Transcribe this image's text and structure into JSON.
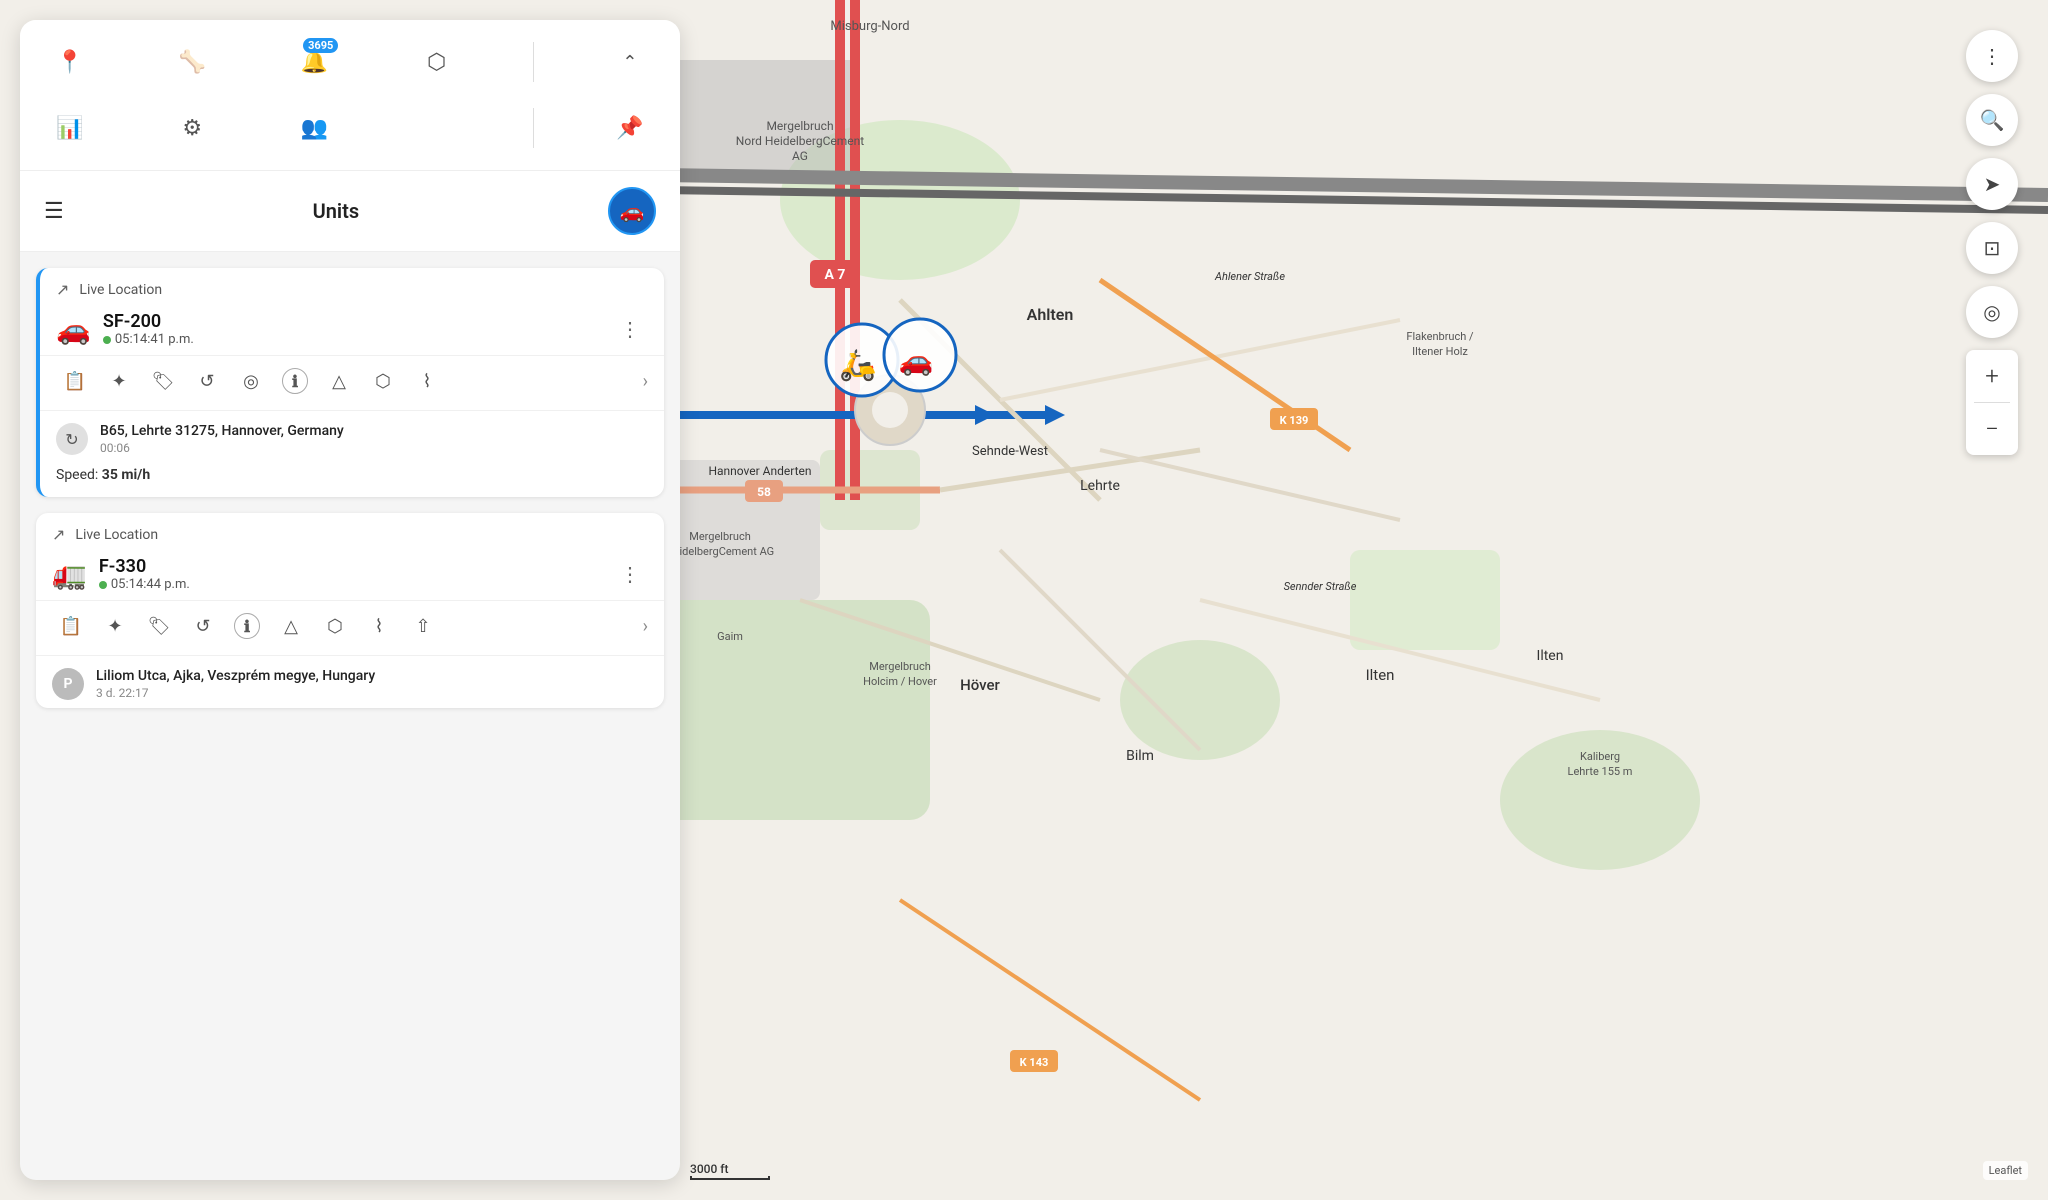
{
  "toolbar": {
    "icons": [
      {
        "name": "location-pin-icon",
        "symbol": "📍",
        "badge": null
      },
      {
        "name": "share-icon",
        "symbol": "🦴",
        "badge": null
      },
      {
        "name": "notifications-icon",
        "symbol": "🔔",
        "badge": "3695"
      },
      {
        "name": "select-area-icon",
        "symbol": "⬡",
        "badge": null
      },
      {
        "name": "collapse-icon",
        "symbol": "⌃",
        "badge": null
      },
      {
        "name": "chart-icon",
        "symbol": "📊",
        "badge": null
      },
      {
        "name": "settings-icon",
        "symbol": "⚙",
        "badge": null
      },
      {
        "name": "users-icon",
        "symbol": "👥",
        "badge": null
      },
      {
        "name": "pin-icon",
        "symbol": "📌",
        "badge": null
      }
    ]
  },
  "units_header": {
    "title": "Units",
    "menu_label": "☰"
  },
  "units": [
    {
      "id": "sf200",
      "live_location_label": "Live Location",
      "name": "SF-200",
      "time": "05:14:41 p.m.",
      "status": "online",
      "address": "B65, Lehrte 31275, Hannover, Germany",
      "time_ago": "00:06",
      "speed_label": "Speed:",
      "speed_value": "35 mi/h",
      "selected": true
    },
    {
      "id": "f330",
      "live_location_label": "Live Location",
      "name": "F-330",
      "time": "05:14:44 p.m.",
      "status": "online",
      "address": "Liliom Utca, Ajka, Veszprém megye, Hungary",
      "time_ago": "3 d. 22:17",
      "speed_label": null,
      "speed_value": null,
      "selected": false
    }
  ],
  "action_icons": [
    {
      "name": "report-icon",
      "symbol": "📋"
    },
    {
      "name": "route-icon",
      "symbol": "✦"
    },
    {
      "name": "bookmark-icon",
      "symbol": "🏷"
    },
    {
      "name": "replay-icon",
      "symbol": "↺"
    },
    {
      "name": "geofence-icon",
      "symbol": "◎"
    },
    {
      "name": "info-icon",
      "symbol": "ℹ"
    },
    {
      "name": "navigation-icon",
      "symbol": "△"
    },
    {
      "name": "shield-icon",
      "symbol": "⬡"
    },
    {
      "name": "path-icon",
      "symbol": "⌇"
    }
  ],
  "action_icons_2": [
    {
      "name": "report-icon",
      "symbol": "📋"
    },
    {
      "name": "route-icon",
      "symbol": "✦"
    },
    {
      "name": "bookmark-icon",
      "symbol": "🏷"
    },
    {
      "name": "replay-icon",
      "symbol": "↺"
    },
    {
      "name": "info-icon",
      "symbol": "ℹ"
    },
    {
      "name": "navigation-icon",
      "symbol": "△"
    },
    {
      "name": "shield-icon",
      "symbol": "⬡"
    },
    {
      "name": "path-icon",
      "symbol": "⌇"
    },
    {
      "name": "share2-icon",
      "symbol": "⇧"
    }
  ],
  "map_controls": {
    "more_label": "⋮",
    "search_label": "🔍",
    "navigate_label": "➤",
    "capture_label": "⊡",
    "locate_label": "◎",
    "zoom_in_label": "+",
    "zoom_out_label": "−"
  },
  "scale": {
    "text": "3000 ft"
  },
  "attribution": {
    "text": "Leaflet"
  },
  "map": {
    "road_a7": "A 7",
    "road_58": "58",
    "road_k139": "K 139",
    "road_k143": "K 143",
    "place_ahlten": "Ahlten",
    "place_hover": "Höver",
    "place_bilm": "Bilm",
    "place_ilten": "Ilten",
    "place_lehrte": "Lehrte",
    "place_sehnde_west": "Sehnde-West",
    "place_hannover_anderten": "Hannover Anderten",
    "place_mergelbruch_nord": "Mergelbruch Nord HeidelbergCement AG",
    "place_mergelbruch": "Mergelbruch HeidelbergCement AG",
    "place_mergelbruch_holcim": "Mergelbruch Holcim / Hover",
    "place_misburg_nord": "Misburg-Nord",
    "place_flakenbruch": "Flakenbruch / Iltener Holz",
    "place_ahlener_strasse": "Ahlener Straße",
    "place_sennder_strasse": "Sennder Straße",
    "place_gaim": "Gaim",
    "place_kaliberg": "Kaliberg Lehrte 155 m"
  }
}
